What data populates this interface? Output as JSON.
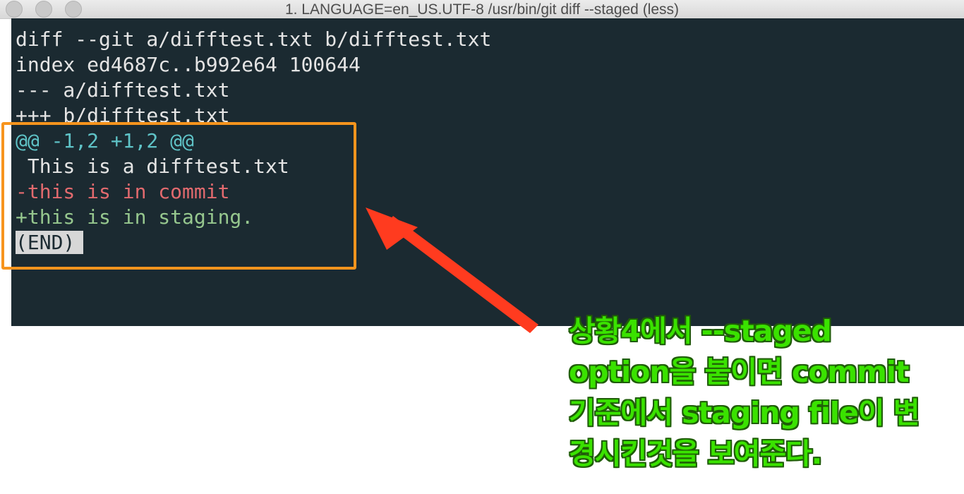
{
  "window": {
    "title": "1. LANGUAGE=en_US.UTF-8 /usr/bin/git diff --staged (less)"
  },
  "terminal": {
    "lines": [
      "diff --git a/difftest.txt b/difftest.txt",
      "index ed4687c..b992e64 100644",
      "--- a/difftest.txt",
      "+++ b/difftest.txt",
      "@@ -1,2 +1,2 @@",
      " This is a difftest.txt",
      "-this is in commit",
      "+this is in staging.",
      "(END)"
    ]
  },
  "annotation": {
    "caption_lines": [
      "상황4에서 --staged",
      "option을 붙이면 commit",
      "기준에서 staging file이 변",
      "경시킨것을 보여준다."
    ],
    "box_color": "#f7941d",
    "arrow_color": "#ff3b1f",
    "caption_color": "#3ae200"
  },
  "colors": {
    "terminal_bg": "#1b2a31",
    "hunk_header": "#5fc3c7",
    "removed": "#e26a6e",
    "added": "#96c78e"
  }
}
